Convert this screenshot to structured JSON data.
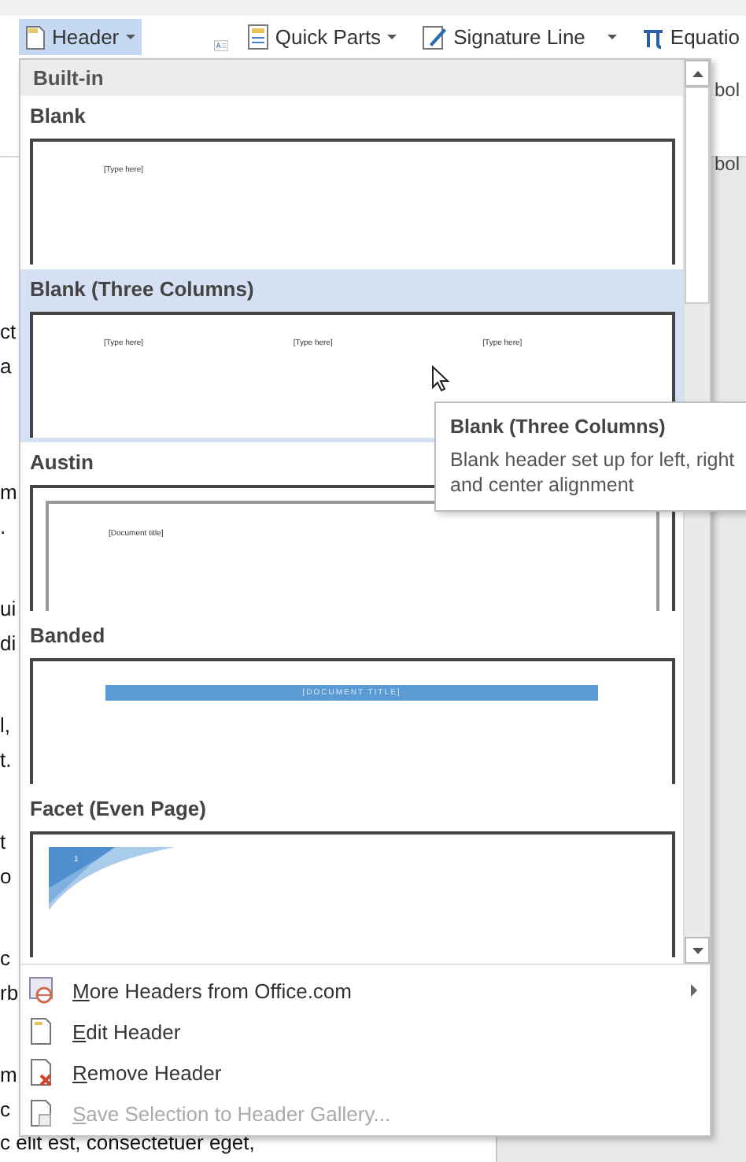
{
  "ribbon": {
    "header_button": {
      "label": "Header",
      "selected": true
    },
    "quick_parts": {
      "label": "Quick Parts"
    },
    "signature_line": {
      "label": "Signature Line"
    },
    "equation": {
      "label": "Equatio"
    },
    "symbol_fragments": [
      "bol",
      "bol"
    ]
  },
  "document": {
    "paragraphs": [
      [
        "ct",
        "a"
      ],
      [
        "m",
        "."
      ],
      [
        "ui",
        "di"
      ],
      [
        "l,",
        "t."
      ],
      [
        "t",
        "o"
      ],
      [
        "c",
        "rb"
      ],
      [
        "m",
        "c",
        "c elit est, consectetuer eget,"
      ]
    ]
  },
  "gallery": {
    "section": "Built-in",
    "items": [
      {
        "name": "Blank",
        "kind": "blank",
        "selected": false,
        "preview_texts": [
          "[Type here]"
        ]
      },
      {
        "name": "Blank (Three Columns)",
        "kind": "three_columns",
        "selected": true,
        "preview_texts": [
          "[Type here]",
          "[Type here]",
          "[Type here]"
        ]
      },
      {
        "name": "Austin",
        "kind": "austin",
        "selected": false,
        "preview_texts": [
          "[Document title]"
        ]
      },
      {
        "name": "Banded",
        "kind": "banded",
        "selected": false,
        "preview_texts": [
          "[DOCUMENT TITLE]"
        ]
      },
      {
        "name": "Facet (Even Page)",
        "kind": "facet",
        "selected": false,
        "preview_texts": [
          "1"
        ]
      }
    ]
  },
  "tooltip": {
    "title": "Blank (Three Columns)",
    "description": "Blank header set up for left, right and center alignment"
  },
  "menu_items": [
    {
      "label": "More Headers from Office.com",
      "kind": "online",
      "disabled": false,
      "submenu": true
    },
    {
      "label": "Edit Header",
      "kind": "edit",
      "disabled": false,
      "submenu": false
    },
    {
      "label": "Remove Header",
      "kind": "remove",
      "disabled": false,
      "submenu": false
    },
    {
      "label": "Save Selection to Header Gallery...",
      "kind": "save",
      "disabled": true,
      "submenu": false
    }
  ]
}
